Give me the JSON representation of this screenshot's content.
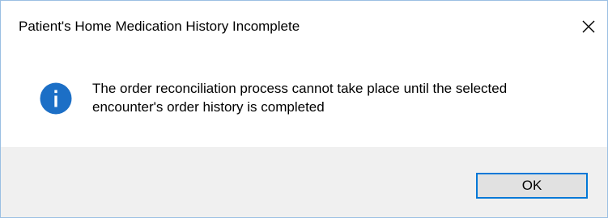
{
  "dialog": {
    "title": "Patient's Home Medication History Incomplete",
    "message_line1": "The order reconciliation process cannot take place until the selected",
    "message_line2": "encounter's order history is completed",
    "ok_label": "OK"
  },
  "icons": {
    "message_icon": "information-icon",
    "close_icon": "close-icon"
  },
  "colors": {
    "info_icon_fill": "#1c6fc6",
    "button_border": "#0078d7",
    "footer_background": "#f0f0f0",
    "window_border": "#9bbfe3"
  }
}
